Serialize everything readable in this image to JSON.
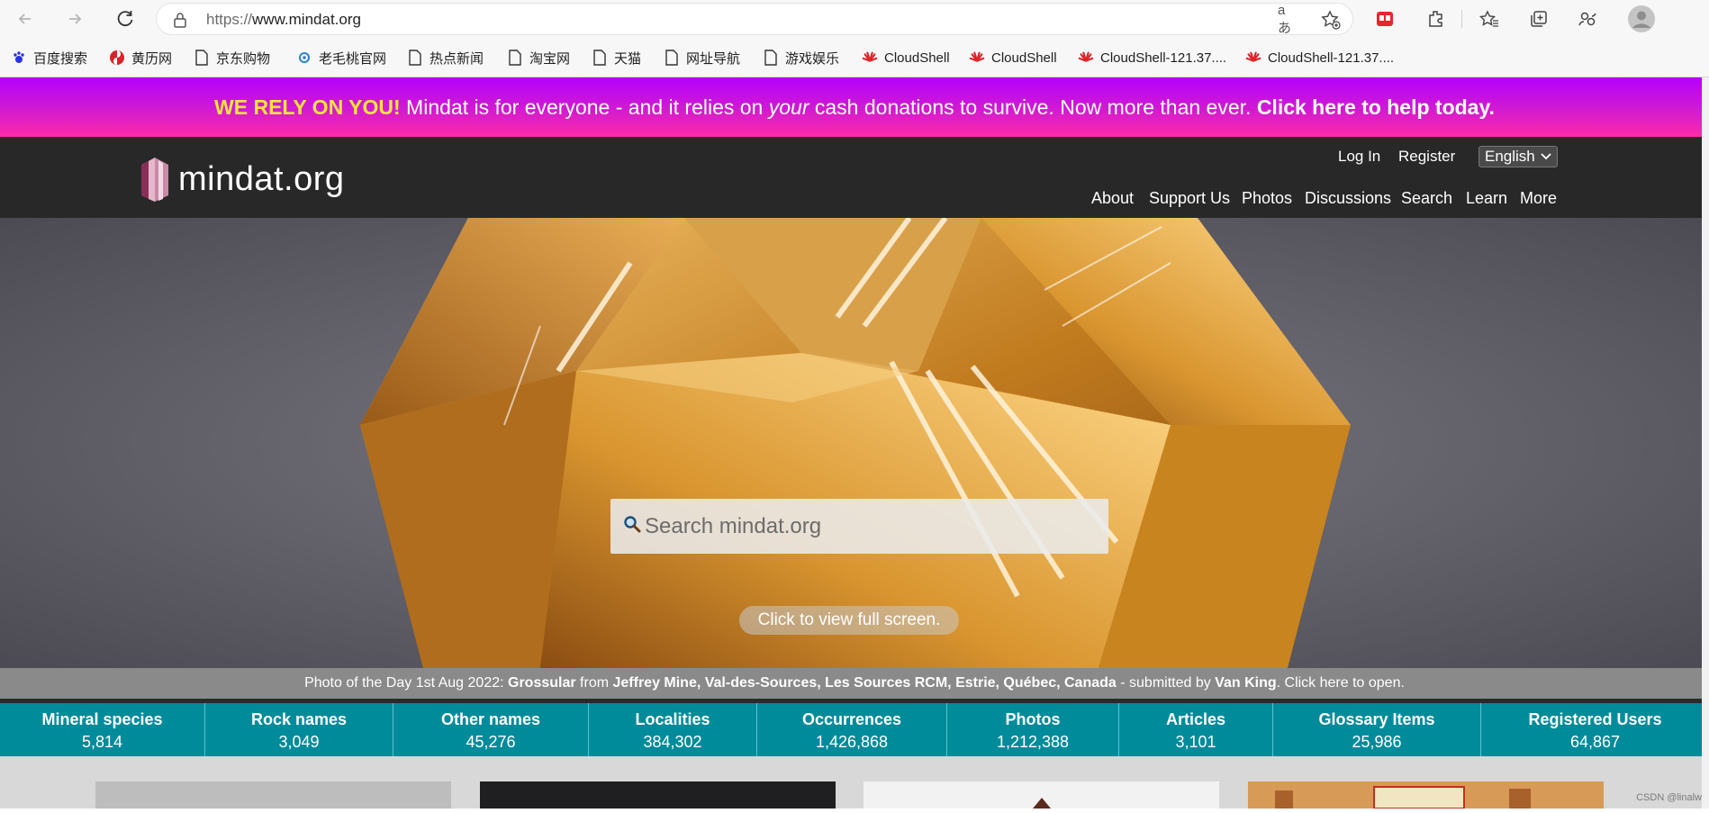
{
  "browser": {
    "url_scheme": "https://",
    "url_host": "www.mindat.org",
    "bookmarks": [
      {
        "label": "百度搜索",
        "icon": "baidu-icon"
      },
      {
        "label": "黄历网",
        "icon": "huangli-icon"
      },
      {
        "label": "京东购物",
        "icon": "page-icon"
      },
      {
        "label": "老毛桃官网",
        "icon": "laomaotao-icon"
      },
      {
        "label": "热点新闻",
        "icon": "page-icon"
      },
      {
        "label": "淘宝网",
        "icon": "page-icon"
      },
      {
        "label": "天猫",
        "icon": "page-icon"
      },
      {
        "label": "网址导航",
        "icon": "page-icon"
      },
      {
        "label": "游戏娱乐",
        "icon": "page-icon"
      },
      {
        "label": "CloudShell",
        "icon": "huawei-icon"
      },
      {
        "label": "CloudShell",
        "icon": "huawei-icon"
      },
      {
        "label": "CloudShell-121.37....",
        "icon": "huawei-icon"
      },
      {
        "label": "CloudShell-121.37....",
        "icon": "huawei-icon"
      }
    ]
  },
  "banner": {
    "highlight": "WE RELY ON YOU!",
    "text_before": " Mindat is for everyone - and it relies on ",
    "emphasis": "your",
    "text_after": " cash donations to survive. Now more than ever. ",
    "cta": "Click here to help today."
  },
  "header": {
    "logo_text": "mindat.org",
    "login": "Log In",
    "register": "Register",
    "language": "English",
    "nav": [
      "About",
      "Support Us",
      "Photos",
      "Discussions",
      "Search",
      "Learn",
      "More"
    ]
  },
  "hero": {
    "search_placeholder": "Search mindat.org",
    "fullscreen_label": "Click to view full screen.",
    "caption": {
      "prefix": "Photo of the Day 1st Aug 2022: ",
      "mineral": "Grossular",
      "from": " from ",
      "locality": "Jeffrey Mine, Val-des-Sources, Les Sources RCM, Estrie, Québec, Canada",
      "submitted": " - submitted by ",
      "author": "Van King",
      "suffix": ". Click here to open."
    }
  },
  "stats": [
    {
      "label": "Mineral species",
      "value": "5,814"
    },
    {
      "label": "Rock names",
      "value": "3,049"
    },
    {
      "label": "Other names",
      "value": "45,276"
    },
    {
      "label": "Localities",
      "value": "384,302"
    },
    {
      "label": "Occurrences",
      "value": "1,426,868"
    },
    {
      "label": "Photos",
      "value": "1,212,388"
    },
    {
      "label": "Articles",
      "value": "3,101"
    },
    {
      "label": "Glossary Items",
      "value": "25,986"
    },
    {
      "label": "Registered Users",
      "value": "64,867"
    }
  ],
  "watermark": "CSDN @linalw",
  "colors": {
    "banner_highlight": "#ffe43d",
    "stats_bg": "#008b9b",
    "header_bg": "#282828"
  }
}
